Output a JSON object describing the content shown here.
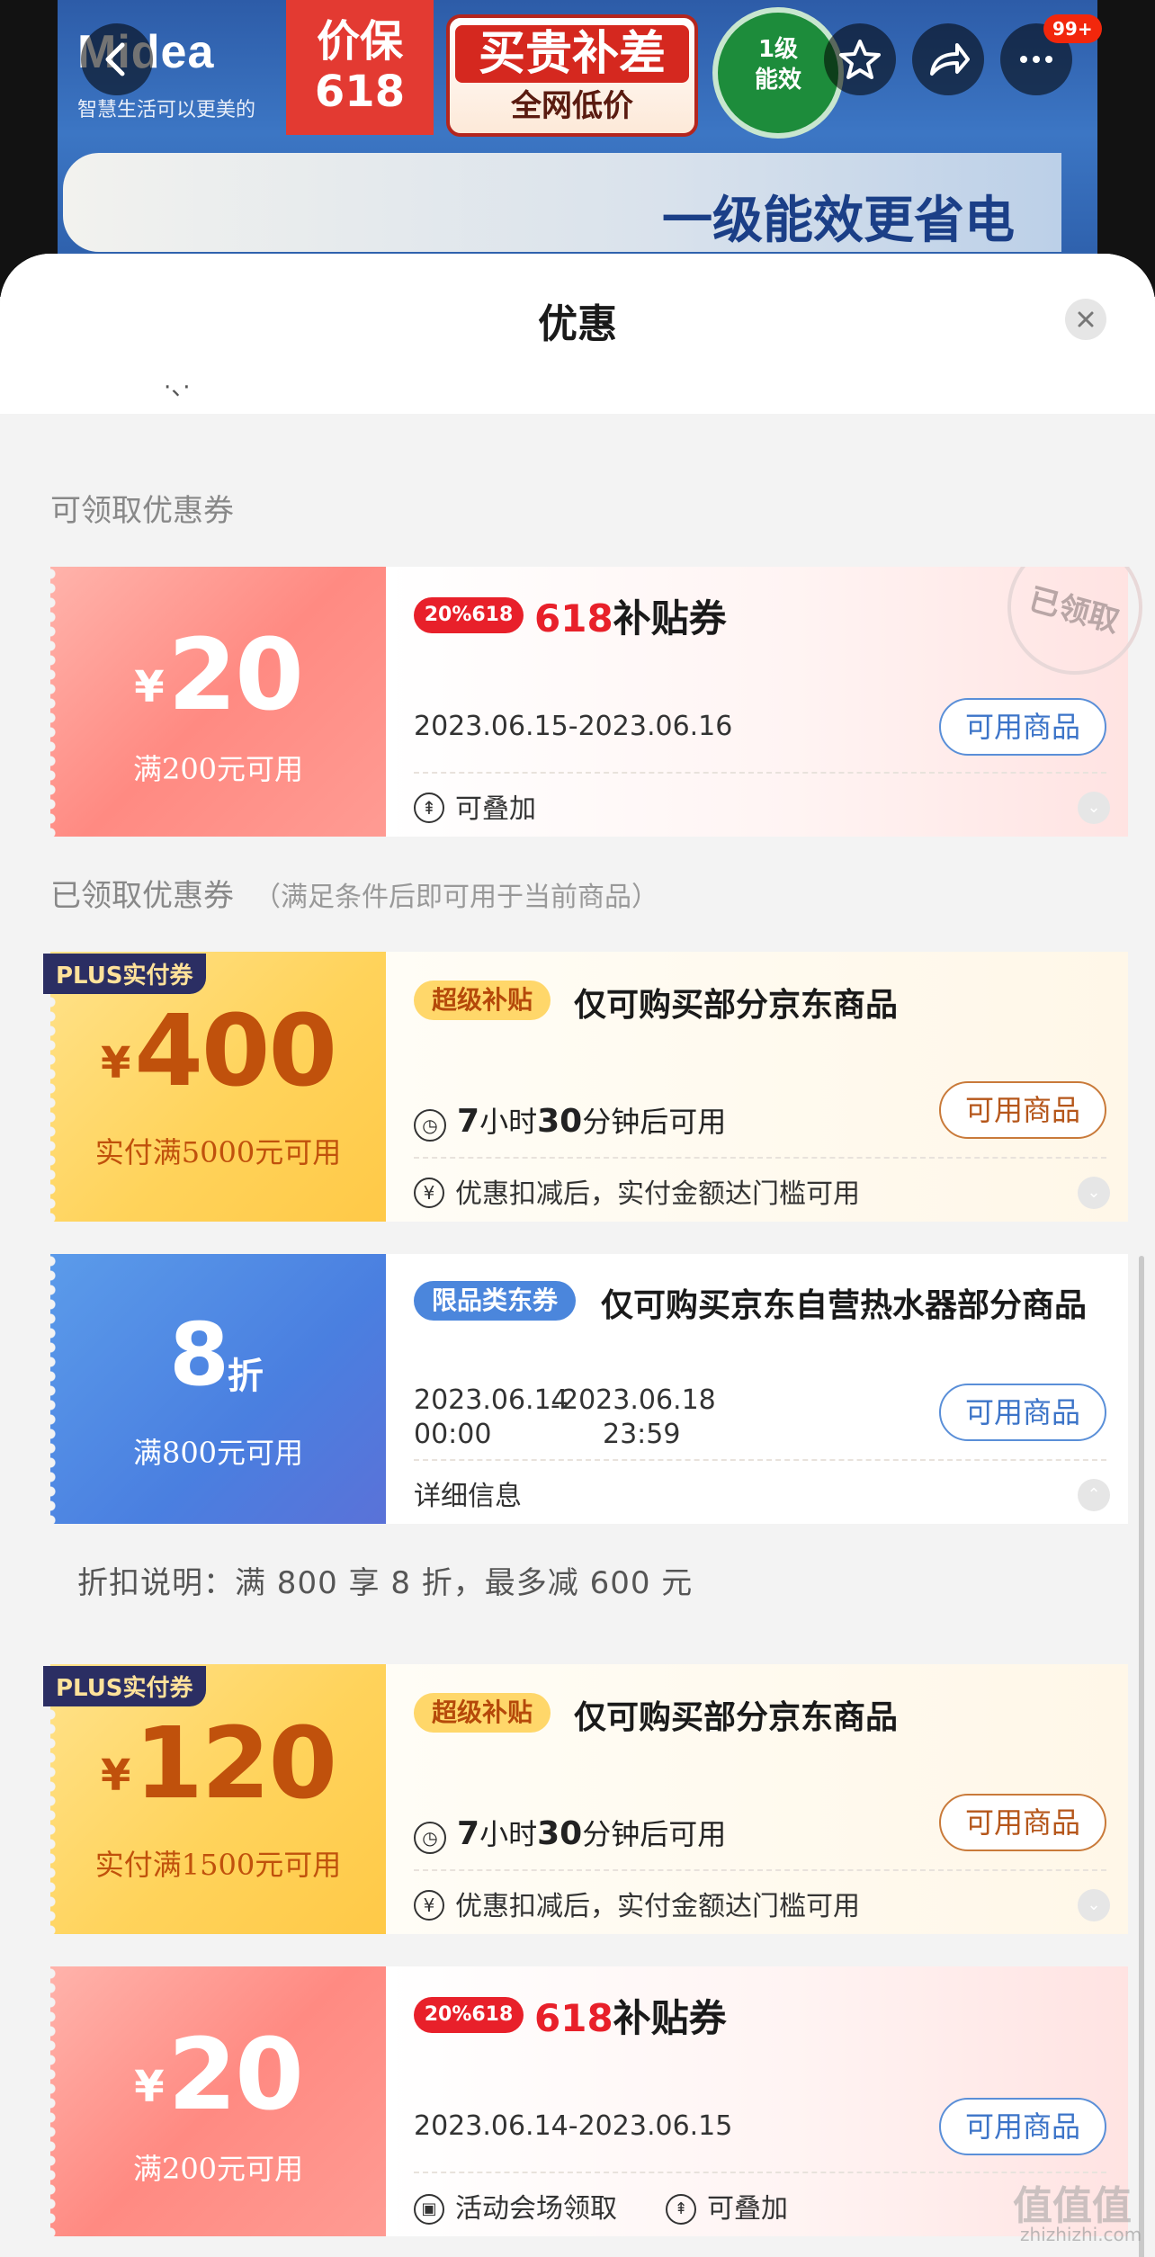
{
  "banner": {
    "brand": "Midea",
    "brand_sub": "智慧生活可以更美的",
    "price_badge": "价保\n618",
    "diff_line1": "买贵补差",
    "diff_line2": "全网低价",
    "energy": "1级\n能效",
    "slogan": "一级能效更省电",
    "more_badge": "99+"
  },
  "icons": {
    "back": "back-icon",
    "fav": "star-icon",
    "share": "share-icon",
    "more": "more-icon",
    "close": "close-icon"
  },
  "sheet": {
    "title": "优惠",
    "dots": "·、·",
    "section_available": "可领取优惠券",
    "section_claimed": "已领取优惠券",
    "section_claimed_hint": "（满足条件后即可用于当前商品）"
  },
  "coupons": [
    {
      "symbol": "¥",
      "amount": "20",
      "condition": "满200元可用",
      "badge": "20%618",
      "title_red": "618",
      "title_rest": "补贴券",
      "date": "2023.06.15-2023.06.16",
      "button": "可用商品",
      "foot": "可叠加",
      "stamp": "已领取"
    },
    {
      "plus": "PLUS实付券",
      "symbol": "¥",
      "amount": "400",
      "condition": "实付满5000元可用",
      "pill": "超级补贴",
      "title": "仅可购买部分京东商品",
      "countdown": [
        "7",
        "小时",
        "30",
        "分钟后可用"
      ],
      "button": "可用商品",
      "foot": "优惠扣减后，实付金额达门槛可用"
    },
    {
      "amount": "8",
      "unit": "折",
      "condition": "满800元可用",
      "pill": "限品类东券",
      "title": "仅可购买京东自营热水器部分商品",
      "date_start": "2023.06.14",
      "time_start": "00:00",
      "date_end": "2023.06.18",
      "time_end": "23:59",
      "dash": "-",
      "button": "可用商品",
      "foot": "详细信息",
      "note": "折扣说明：满 800 享 8 折，最多减 600 元"
    },
    {
      "plus": "PLUS实付券",
      "symbol": "¥",
      "amount": "120",
      "condition": "实付满1500元可用",
      "pill": "超级补贴",
      "title": "仅可购买部分京东商品",
      "countdown": [
        "7",
        "小时",
        "30",
        "分钟后可用"
      ],
      "button": "可用商品",
      "foot": "优惠扣减后，实付金额达门槛可用"
    },
    {
      "symbol": "¥",
      "amount": "20",
      "condition": "满200元可用",
      "badge": "20%618",
      "title_red": "618",
      "title_rest": "补贴券",
      "date": "2023.06.14-2023.06.15",
      "button": "可用商品",
      "foot_a": "活动会场领取",
      "foot_b": "可叠加"
    }
  ],
  "watermark": "值值值",
  "watermark_sub": "zhizhizhi.com",
  "colors": {
    "accent_red": "#e8202a",
    "blue_coupon": "#4a7fe0",
    "gold_coupon": "#ffd35b",
    "pink_coupon": "#ff8a82"
  }
}
